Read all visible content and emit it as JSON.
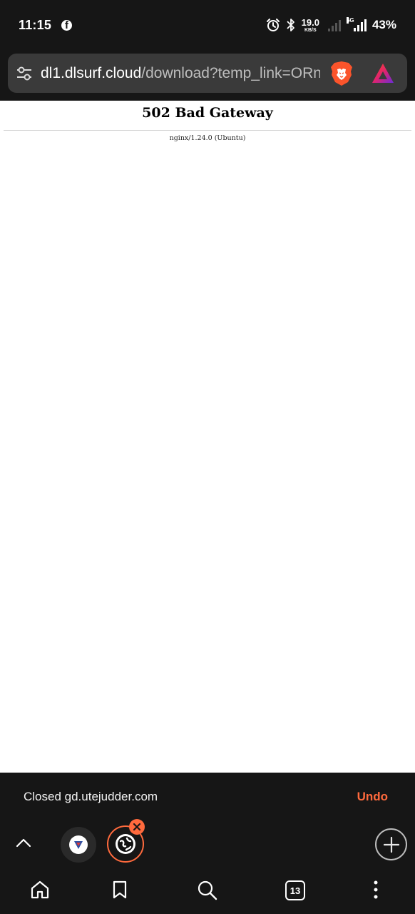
{
  "status_bar": {
    "time": "11:15",
    "net_speed_value": "19.0",
    "net_speed_unit": "KB/S",
    "network_type": "5G",
    "battery": "43%",
    "icons": [
      "facebook-icon",
      "alarm-icon",
      "bluetooth-icon",
      "signal-icon",
      "battery-indicator"
    ]
  },
  "address_bar": {
    "url_host": "dl1.dlsurf.cloud",
    "url_path": "/download?temp_link=ORnj",
    "icons": [
      "site-settings-icon",
      "brave-shields-icon",
      "brave-rewards-icon"
    ],
    "colors": {
      "bar_bg": "#3a3a3a",
      "brave_orange": "#fb542b"
    }
  },
  "page": {
    "heading": "502 Bad Gateway",
    "server": "nginx/1.24.0 (Ubuntu)"
  },
  "snackbar": {
    "message": "Closed gd.utejudder.com",
    "undo_label": "Undo",
    "accent": "#ff6a3d"
  },
  "tab_strip": {
    "icons": [
      "chevron-up-icon",
      "tab-favicon",
      "tab-favicon-globe",
      "close-icon",
      "plus-icon"
    ]
  },
  "toolbar": {
    "tab_count": "13",
    "icons": [
      "home-icon",
      "bookmark-icon",
      "search-icon",
      "tabs-icon",
      "more-vertical-icon"
    ]
  }
}
